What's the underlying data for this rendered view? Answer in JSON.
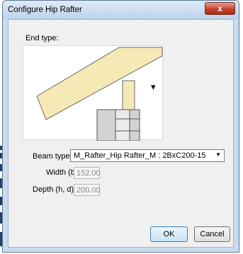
{
  "dialog": {
    "title": "Configure Hip Rafter",
    "close_glyph": "x",
    "end_type_label": "End type:",
    "beam_type_label": "Beam type:",
    "beam_type_value": "M_Rafter_Hip Rafter_M : 2BxC200-15",
    "width_label": "Width (b)",
    "width_value": "152.00",
    "depth_label": "Depth (h, d)",
    "depth_value": "200.00",
    "ok_label": "OK",
    "cancel_label": "Cancel"
  },
  "preview_icons": {
    "dropdown_glyph": "▾",
    "select_arrow_glyph": "▼"
  },
  "colors": {
    "rafter_fill": "#f5e9b5",
    "rafter_stroke": "#6b6b6b",
    "window_frame": "#c8dbef",
    "close_button": "#c2432b"
  }
}
